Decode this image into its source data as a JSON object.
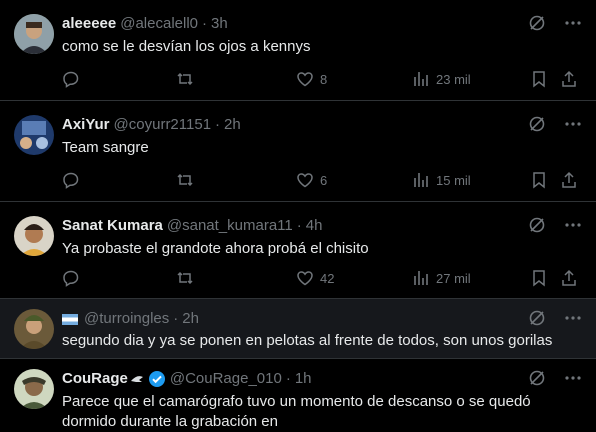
{
  "tweets": [
    {
      "name": "aleeeee",
      "handle": "@alecalell0",
      "time": "3h",
      "text": "como se le desvían los ojos a kennys",
      "likes": "8",
      "views": "23 mil"
    },
    {
      "name": "AxiYur",
      "handle": "@coyurr21151",
      "time": "2h",
      "text": "Team sangre",
      "likes": "6",
      "views": "15 mil"
    },
    {
      "name": "Sanat Kumara",
      "handle": "@sanat_kumara11",
      "time": "4h",
      "text": "Ya probaste el grandote ahora probá el chisito",
      "likes": "42",
      "views": "27 mil"
    },
    {
      "name": "",
      "handle": "@turroingles",
      "time": "2h",
      "text": "segundo dia y ya se ponen en pelotas al frente de todos, son unos gorilas",
      "flag": "argentina-flag-icon"
    },
    {
      "name": "CouRage",
      "handle": "@CouRage_010",
      "time": "1h",
      "text": "Parece que el camarógrafo tuvo un momento de descanso o se quedó dormido durante la grabación en",
      "verified_color": "#1d9bf0"
    }
  ],
  "colors": {
    "background": "#000000",
    "text": "#e7e9ea",
    "secondary": "#71767b",
    "divider": "#2f3336",
    "verified": "#1d9bf0"
  }
}
